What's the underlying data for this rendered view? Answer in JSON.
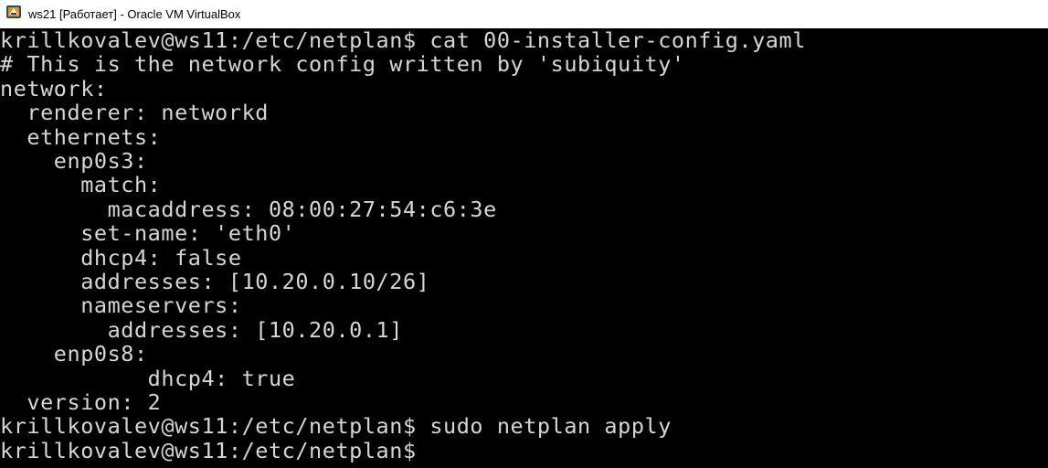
{
  "window": {
    "title": "ws21 [Работает] - Oracle VM VirtualBox",
    "icon": "virtualbox-icon"
  },
  "terminal": {
    "background": "#000000",
    "foreground": "#d6d6d6",
    "lines": [
      "krillkovalev@ws11:/etc/netplan$ cat 00-installer-config.yaml",
      "# This is the network config written by 'subiquity'",
      "network:",
      "  renderer: networkd",
      "  ethernets:",
      "    enp0s3:",
      "      match:",
      "        macaddress: 08:00:27:54:c6:3e",
      "      set-name: 'eth0'",
      "      dhcp4: false",
      "      addresses: [10.20.0.10/26]",
      "      nameservers:",
      "        addresses: [10.20.0.1]",
      "    enp0s8:",
      "           dhcp4: true",
      "  version: 2",
      "krillkovalev@ws11:/etc/netplan$ sudo netplan apply",
      "krillkovalev@ws11:/etc/netplan$"
    ]
  }
}
